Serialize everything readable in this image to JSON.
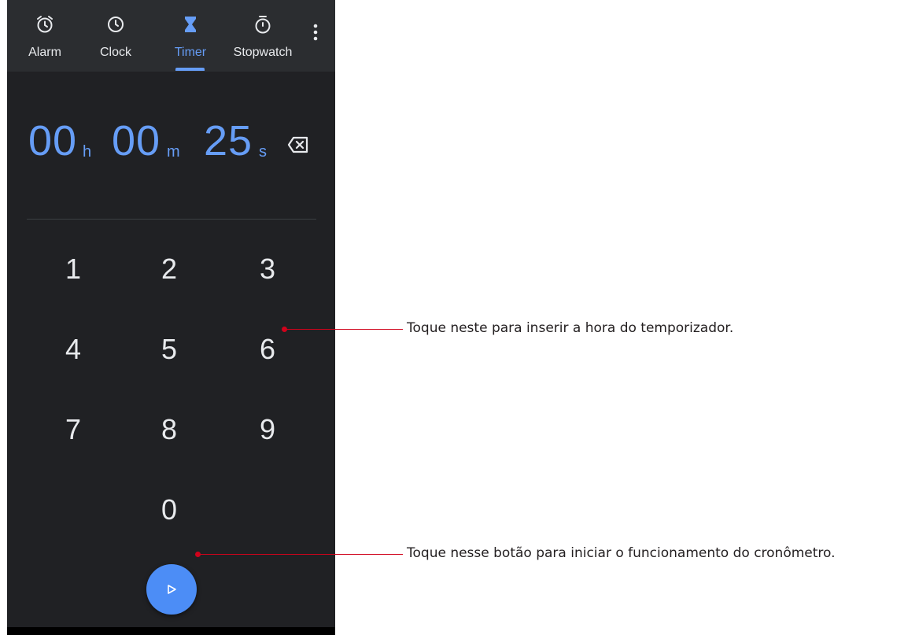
{
  "tabs": [
    {
      "label": "Alarm",
      "icon": "alarm-icon",
      "active": false
    },
    {
      "label": "Clock",
      "icon": "clock-icon",
      "active": false
    },
    {
      "label": "Timer",
      "icon": "hourglass-icon",
      "active": true
    },
    {
      "label": "Stopwatch",
      "icon": "stopwatch-icon",
      "active": false
    }
  ],
  "timer": {
    "hours": "00",
    "hours_unit": "h",
    "minutes": "00",
    "minutes_unit": "m",
    "seconds": "25",
    "seconds_unit": "s"
  },
  "keypad": [
    "1",
    "2",
    "3",
    "4",
    "5",
    "6",
    "7",
    "8",
    "9",
    "0"
  ],
  "callouts": {
    "keypad": "Toque neste para inserir a hora do temporizador.",
    "start": "Toque nesse botão para iniciar o funcionamento do cronômetro."
  },
  "colors": {
    "accent": "#669df6",
    "fab": "#4c8df6",
    "background": "#202124",
    "callout": "#d0021b"
  }
}
